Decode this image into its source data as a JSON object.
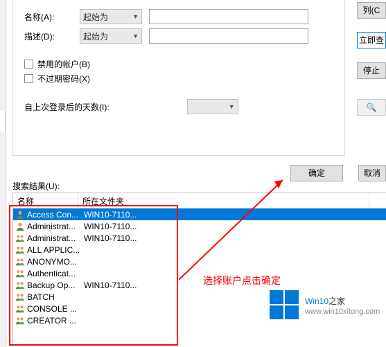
{
  "form": {
    "name_label": "名称(A):",
    "desc_label": "描述(D):",
    "combo_val": "起始为",
    "chk_disabled": "禁用的帐户(B)",
    "chk_noexpire": "不过期密码(X)",
    "days_label": "自上次登录后的天数(I):"
  },
  "rightbtn": {
    "lie": "列(C",
    "cha": "立即查",
    "ting": "停止",
    "mag": "🔍"
  },
  "bottom": {
    "ok": "确定",
    "cancel": "取消",
    "reslabel": "搜索结果(U):"
  },
  "grid": {
    "h1": "名称",
    "h2": "所在文件夹",
    "rows": [
      {
        "n": "Access Con...",
        "f": "WIN10-7110...",
        "sel": true,
        "g": false
      },
      {
        "n": "Administrat...",
        "f": "WIN10-7110...",
        "sel": false,
        "g": false
      },
      {
        "n": "Administrat...",
        "f": "WIN10-7110...",
        "sel": false,
        "g": true
      },
      {
        "n": "ALL APPLIC...",
        "f": "",
        "sel": false,
        "g": true
      },
      {
        "n": "ANONYMO...",
        "f": "",
        "sel": false,
        "g": true
      },
      {
        "n": "Authenticat...",
        "f": "",
        "sel": false,
        "g": true
      },
      {
        "n": "Backup Op...",
        "f": "WIN10-7110...",
        "sel": false,
        "g": true
      },
      {
        "n": "BATCH",
        "f": "",
        "sel": false,
        "g": true
      },
      {
        "n": "CONSOLE ...",
        "f": "",
        "sel": false,
        "g": true
      },
      {
        "n": "CREATOR ...",
        "f": "",
        "sel": false,
        "g": true
      }
    ]
  },
  "annotation": "选择账户点击确定",
  "wm": {
    "t1a": "Win10",
    "t1b": "之家",
    "t2": "www.win10xitong.com"
  }
}
